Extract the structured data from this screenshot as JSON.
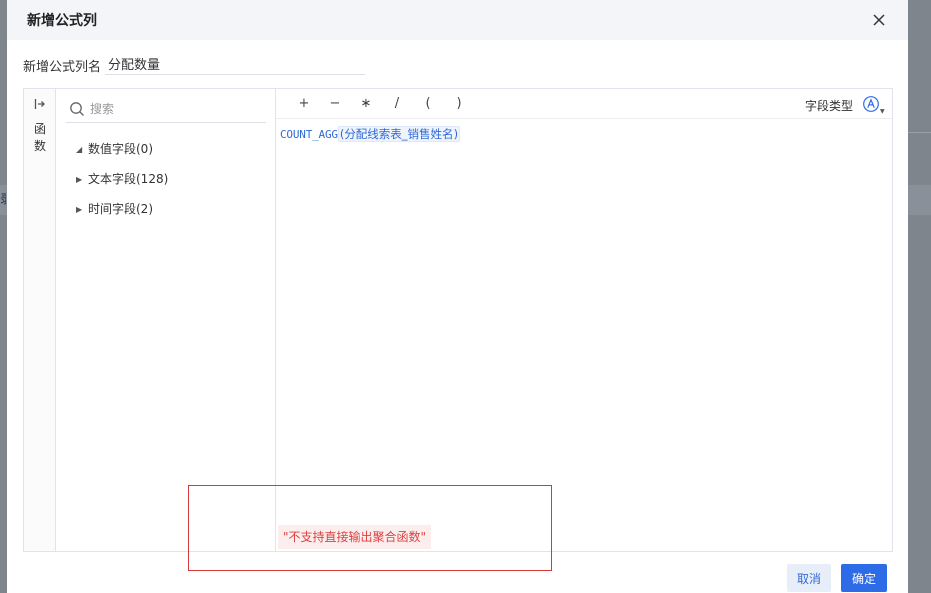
{
  "dialog": {
    "title": "新增公式列",
    "close_icon": "close-icon"
  },
  "name_field": {
    "label": "新增公式列名",
    "value": "分配数量"
  },
  "function_panel": {
    "label": "函数",
    "expand_icon": "expand-arrow-icon"
  },
  "field_panel": {
    "search_placeholder": "搜索",
    "search_icon": "search-icon",
    "groups": [
      {
        "label": "数值字段(0)",
        "expanded": true
      },
      {
        "label": "文本字段(128)",
        "expanded": false
      },
      {
        "label": "时间字段(2)",
        "expanded": false
      }
    ]
  },
  "toolbar": {
    "operators": [
      "+",
      "−",
      "∗",
      "/",
      "(",
      ")"
    ],
    "field_type_label": "字段类型",
    "field_type_icon": "circled-a-icon"
  },
  "formula": {
    "function_name": "COUNT_AGG",
    "open_paren": "(",
    "argument": "分配线索表_销售姓名",
    "close_paren": ")"
  },
  "error_message": "\"不支持直接输出聚合函数\"",
  "buttons": {
    "cancel": "取消",
    "confirm": "确定"
  },
  "colors": {
    "primary": "#2e6be6",
    "formula": "#2f6bd6",
    "error_text": "#e04040",
    "error_bg": "#fdeeee",
    "highlight_border": "#d43a3a"
  },
  "background": {
    "partial_char": "录"
  }
}
